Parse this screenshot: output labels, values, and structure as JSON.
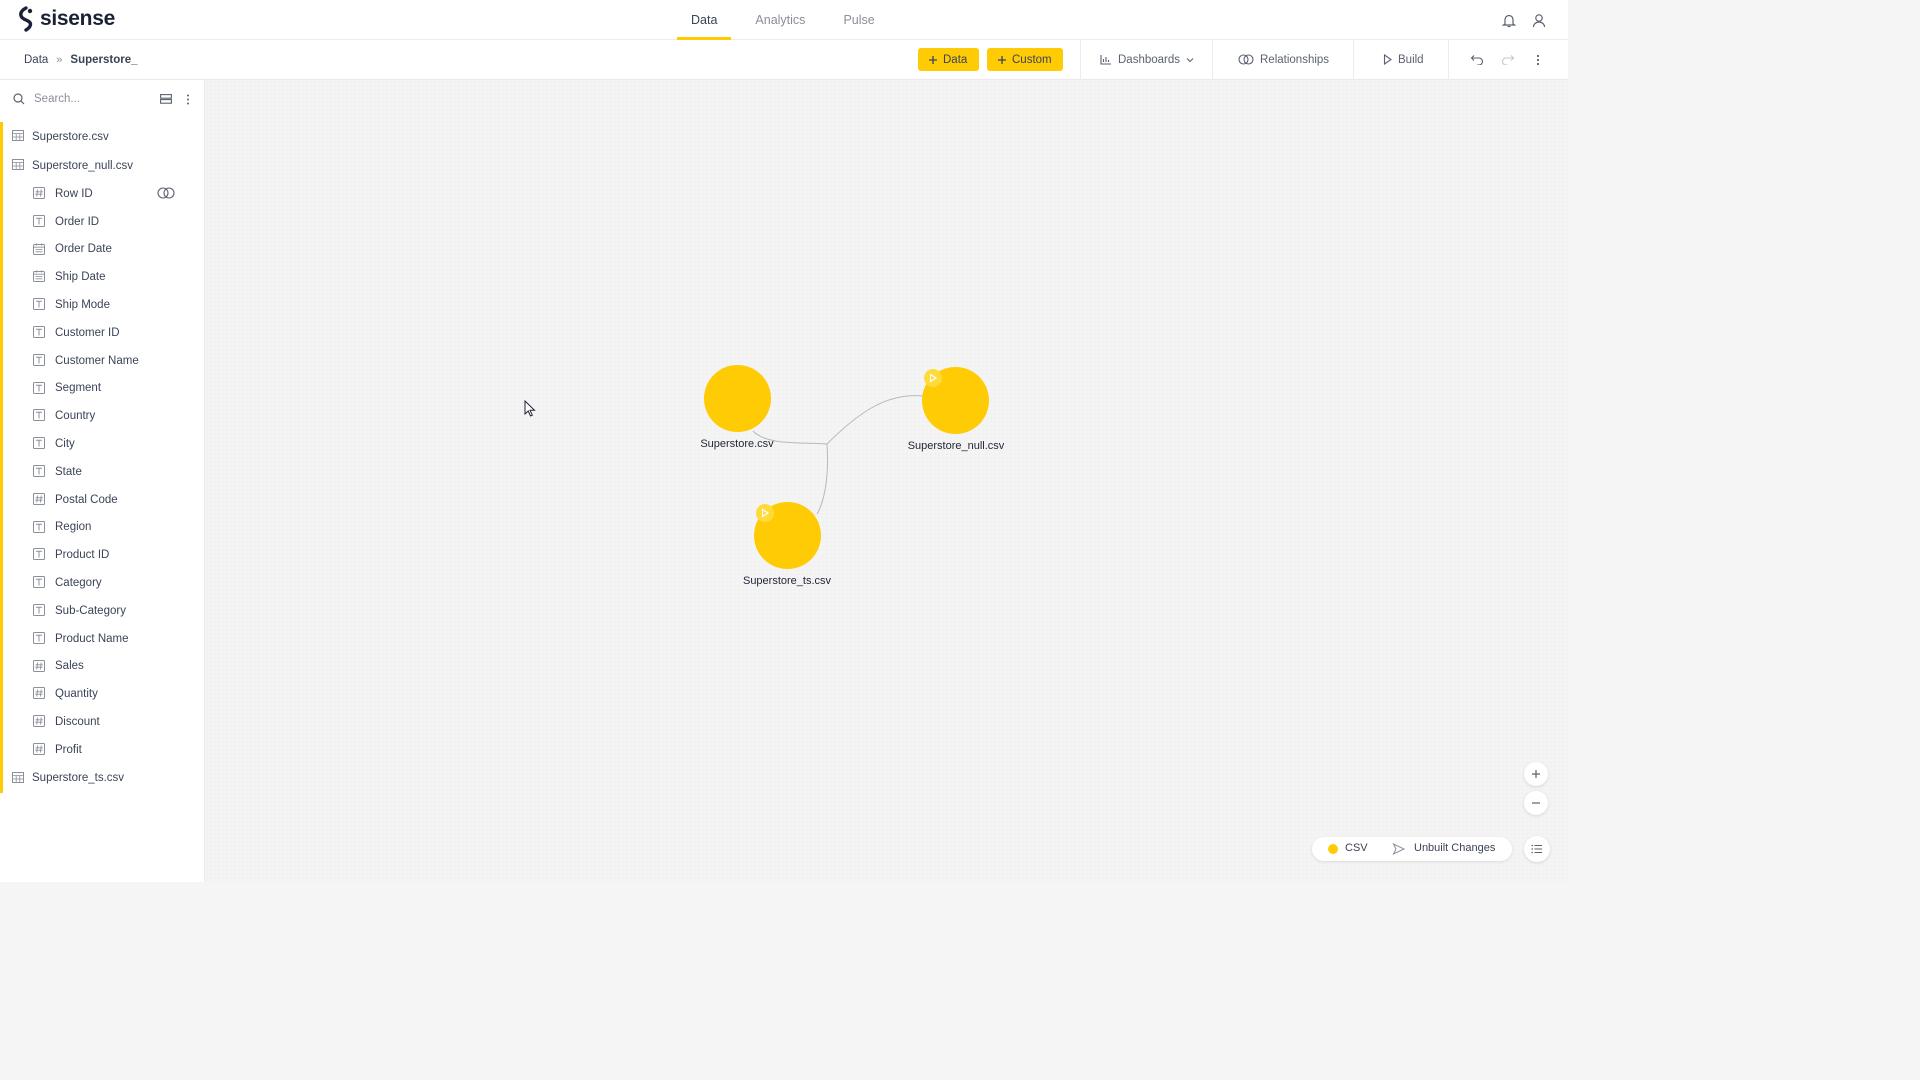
{
  "app": {
    "logo_text": "sisense"
  },
  "main_tabs": [
    {
      "label": "Data",
      "active": true
    },
    {
      "label": "Analytics",
      "active": false
    },
    {
      "label": "Pulse",
      "active": false
    }
  ],
  "breadcrumb": {
    "root": "Data",
    "separator": "»",
    "current": "Superstore_"
  },
  "toolbar": {
    "add_data_label": "Data",
    "custom_label": "Custom",
    "dashboards_label": "Dashboards",
    "relationships_label": "Relationships",
    "build_label": "Build"
  },
  "search": {
    "placeholder": "Search..."
  },
  "tables": [
    {
      "name": "Superstore.csv"
    },
    {
      "name": "Superstore_null.csv",
      "expanded": true
    },
    {
      "name": "Superstore_ts.csv"
    }
  ],
  "fields": [
    {
      "name": "Row ID",
      "type": "number",
      "has_relationship": true
    },
    {
      "name": "Order ID",
      "type": "text"
    },
    {
      "name": "Order Date",
      "type": "date"
    },
    {
      "name": "Ship Date",
      "type": "date"
    },
    {
      "name": "Ship Mode",
      "type": "text"
    },
    {
      "name": "Customer ID",
      "type": "text"
    },
    {
      "name": "Customer Name",
      "type": "text"
    },
    {
      "name": "Segment",
      "type": "text"
    },
    {
      "name": "Country",
      "type": "text"
    },
    {
      "name": "City",
      "type": "text"
    },
    {
      "name": "State",
      "type": "text"
    },
    {
      "name": "Postal Code",
      "type": "number"
    },
    {
      "name": "Region",
      "type": "text"
    },
    {
      "name": "Product ID",
      "type": "text"
    },
    {
      "name": "Category",
      "type": "text"
    },
    {
      "name": "Sub-Category",
      "type": "text"
    },
    {
      "name": "Product Name",
      "type": "text"
    },
    {
      "name": "Sales",
      "type": "number"
    },
    {
      "name": "Quantity",
      "type": "number"
    },
    {
      "name": "Discount",
      "type": "number"
    },
    {
      "name": "Profit",
      "type": "number"
    }
  ],
  "diagram": {
    "nodes": [
      {
        "label": "Superstore.csv",
        "badge": false
      },
      {
        "label": "Superstore_null.csv",
        "badge": true
      },
      {
        "label": "Superstore_ts.csv",
        "badge": true
      }
    ]
  },
  "legend": {
    "csv_label": "CSV",
    "unbuilt_label": "Unbuilt Changes"
  },
  "colors": {
    "accent": "#ffcb05",
    "text": "#3a4356"
  }
}
